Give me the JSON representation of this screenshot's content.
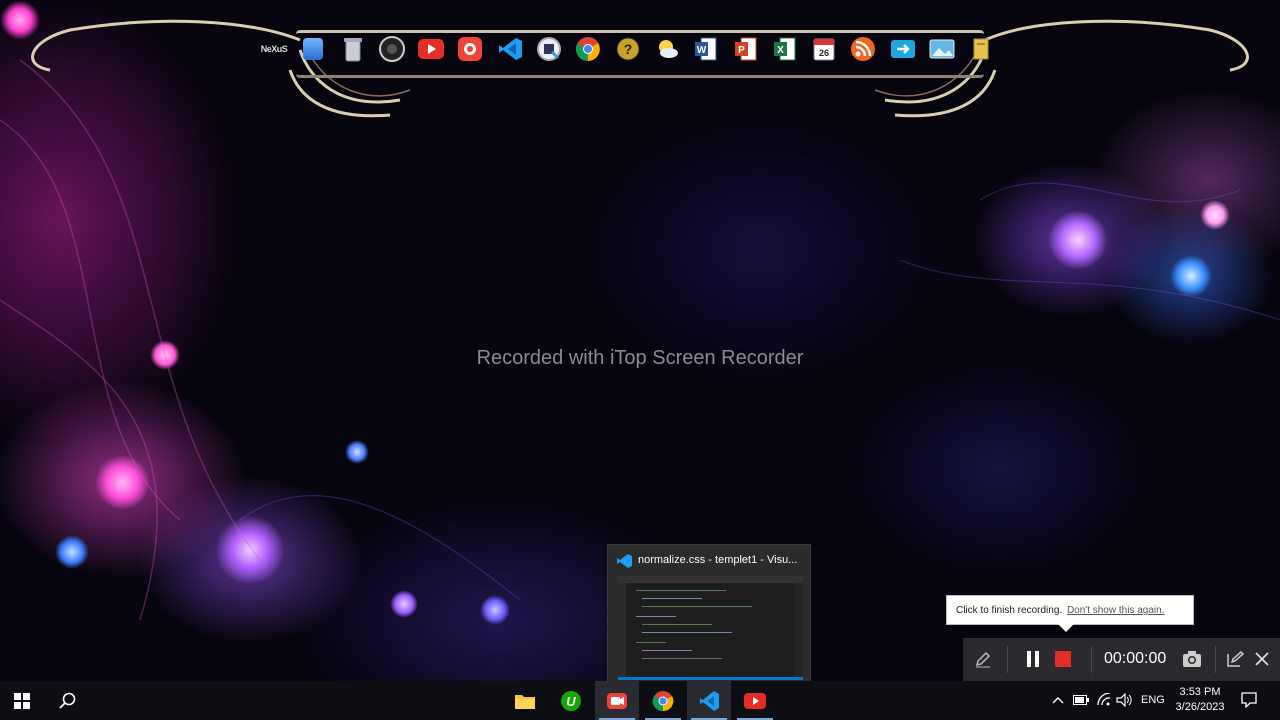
{
  "desktop": {
    "watermark": "Recorded with iTop Screen Recorder"
  },
  "dock": {
    "nexus_label": "NeXuS",
    "calendar_day": "26",
    "icons": [
      "finder-icon",
      "recycle-bin-icon",
      "camera-icon",
      "youtube-icon",
      "itop-recorder-icon",
      "vscode-icon",
      "browser-icon",
      "chrome-icon",
      "help-icon",
      "weather-icon",
      "word-icon",
      "powerpoint-icon",
      "excel-icon",
      "calendar-icon",
      "rss-icon",
      "transfer-icon",
      "photos-icon",
      "folder-icon"
    ]
  },
  "preview": {
    "title": "normalize.css - templet1 - Visu..."
  },
  "tooltip": {
    "text": "Click to finish recording.",
    "link": "Don't show this again."
  },
  "recorder": {
    "timer": "00:00:00"
  },
  "taskbar": {
    "language": "ENG",
    "time": "3:53 PM",
    "date": "3/26/2023"
  },
  "colors": {
    "accent": "#007acc",
    "record_red": "#e52d27",
    "taskbar_bg": "#0d0d14"
  }
}
